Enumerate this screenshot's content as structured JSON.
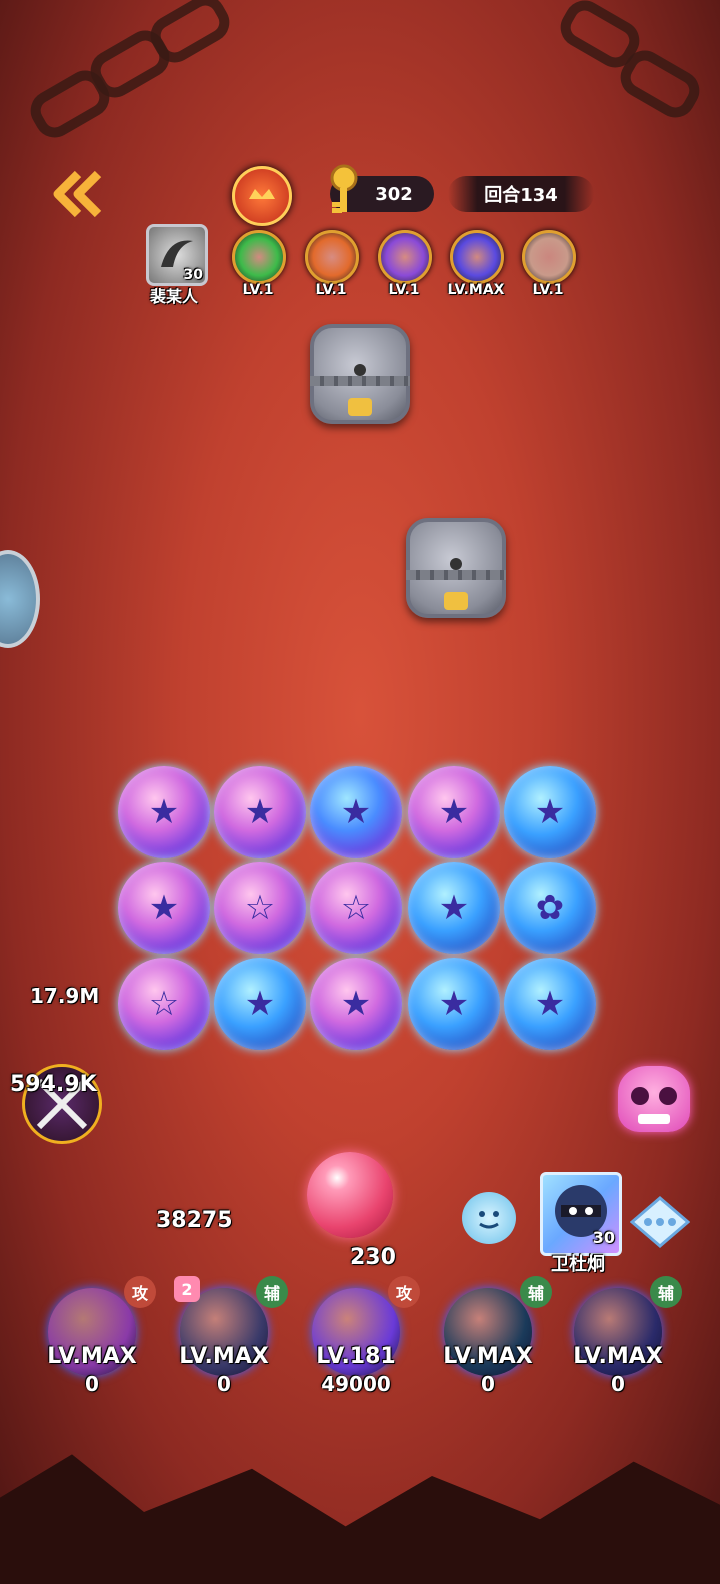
{
  "hud": {
    "key_count": "302",
    "round_label": "回合134",
    "player_name": "裴某人",
    "player_level": "30"
  },
  "badges": [
    {
      "name": "green-arrow-badge",
      "level": "LV.1",
      "color": "#3dbb4a"
    },
    {
      "name": "monkey-badge",
      "level": "LV.1",
      "color": "#e26a2c"
    },
    {
      "name": "purple-feather-badge",
      "level": "LV.1",
      "color": "#8a4ad8"
    },
    {
      "name": "lightning-badge",
      "level": "LV.MAX",
      "color": "#5a4ae0"
    },
    {
      "name": "tentacle-badge",
      "level": "LV.1",
      "color": "#c99a8a"
    }
  ],
  "damage": {
    "damage_1": "17.9M",
    "damage_2": "594.9K"
  },
  "ball": {
    "score": "38275",
    "count": "230"
  },
  "partner": {
    "name": "卫杜炯",
    "level": "30"
  },
  "skills": [
    {
      "level": "LV.MAX",
      "value": "0",
      "tag": "攻",
      "tag_color": "#c04a3a",
      "orb_color": "#8a3aa8"
    },
    {
      "level": "LV.MAX",
      "value": "0",
      "tag": "辅",
      "tag_color": "#3a8a4a",
      "orb_color": "#3a3a6a",
      "extra": "2"
    },
    {
      "level": "LV.181",
      "value": "49000",
      "tag": "攻",
      "tag_color": "#c04a3a",
      "orb_color": "#6a3ad8"
    },
    {
      "level": "LV.MAX",
      "value": "0",
      "tag": "辅",
      "tag_color": "#3a8a4a",
      "orb_color": "#1a3a5a"
    },
    {
      "level": "LV.MAX",
      "value": "0",
      "tag": "辅",
      "tag_color": "#3a8a4a",
      "orb_color": "#2a2a6a"
    }
  ]
}
